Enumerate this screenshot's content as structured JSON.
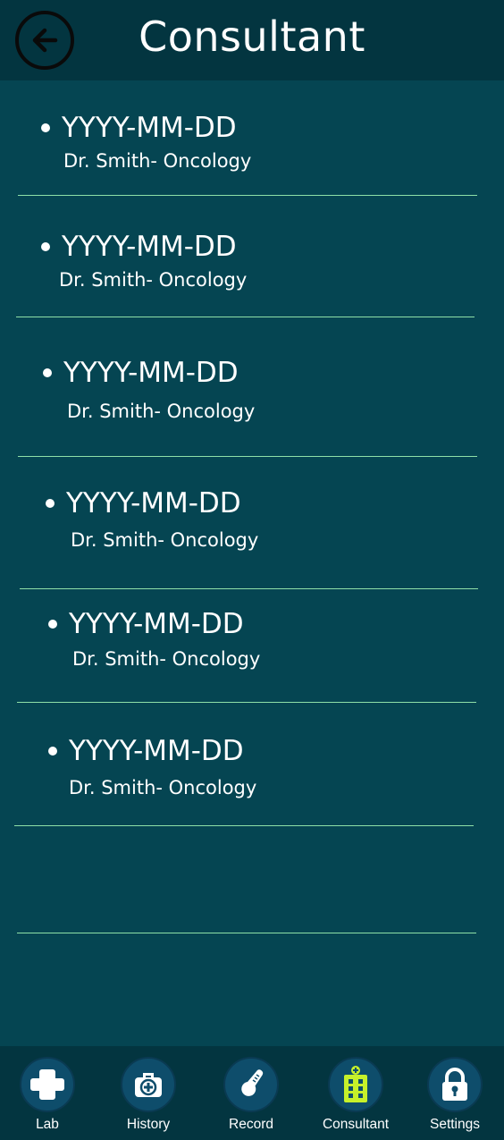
{
  "header": {
    "title": "Consultant",
    "back_icon": "arrow-left-circle-icon"
  },
  "appointments": [
    {
      "date": "YYYY-MM-DD",
      "doctor": "Dr. Smith- Oncology"
    },
    {
      "date": "YYYY-MM-DD",
      "doctor": "Dr. Smith- Oncology"
    },
    {
      "date": "YYYY-MM-DD",
      "doctor": "Dr. Smith- Oncology"
    },
    {
      "date": "YYYY-MM-DD",
      "doctor": "Dr. Smith- Oncology"
    },
    {
      "date": "YYYY-MM-DD",
      "doctor": "Dr. Smith- Oncology"
    },
    {
      "date": "YYYY-MM-DD",
      "doctor": "Dr. Smith- Oncology"
    }
  ],
  "nav": {
    "items": [
      {
        "label": "Lab",
        "icon": "medical-cross-icon"
      },
      {
        "label": "History",
        "icon": "medical-bag-icon"
      },
      {
        "label": "Record",
        "icon": "thermometer-icon"
      },
      {
        "label": "Consultant",
        "icon": "hospital-building-icon",
        "active": true
      },
      {
        "label": "Settings",
        "icon": "padlock-icon"
      }
    ]
  },
  "colors": {
    "background": "#054552",
    "header": "#033540",
    "divider": "#8fe0a8",
    "nav_circle": "#0e4d6b",
    "active_icon": "#c6f02a"
  }
}
